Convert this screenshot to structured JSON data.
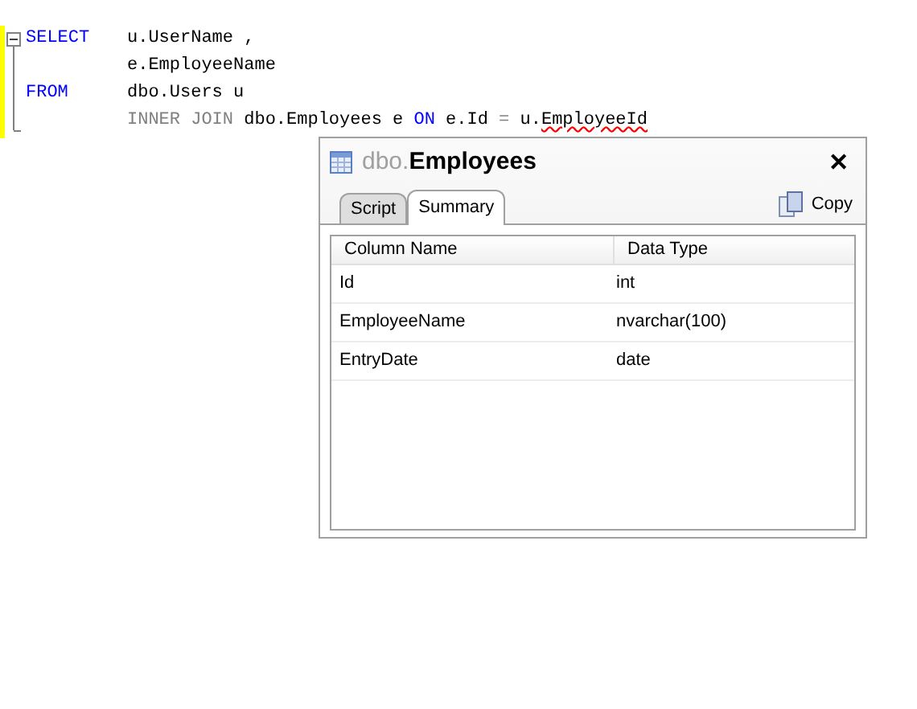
{
  "editor": {
    "lines": [
      {
        "keyword": "SELECT",
        "tokens": [
          {
            "text": "u.UserName ,",
            "kind": "plain"
          }
        ]
      },
      {
        "tokens": [
          {
            "text": "e.EmployeeName",
            "kind": "plain"
          }
        ]
      },
      {
        "keyword": "FROM",
        "tokens": [
          {
            "text": "dbo.Users u",
            "kind": "plain"
          }
        ]
      },
      {
        "tokens": [
          {
            "text": "INNER JOIN",
            "kind": "operator"
          },
          {
            "text": " dbo.Employees e ",
            "kind": "plain"
          },
          {
            "text": "ON",
            "kind": "keyword"
          },
          {
            "text": " e.Id ",
            "kind": "plain"
          },
          {
            "text": "=",
            "kind": "operator"
          },
          {
            "text": " u.",
            "kind": "plain"
          },
          {
            "text": "EmployeeId",
            "kind": "error"
          }
        ]
      }
    ]
  },
  "popup": {
    "schema": "dbo.",
    "name": "Employees",
    "close": "✕",
    "tabs": [
      {
        "label": "Script",
        "selected": false
      },
      {
        "label": "Summary",
        "selected": true
      }
    ],
    "copy": "Copy",
    "columns": [
      "Column Name",
      "Data Type"
    ],
    "rows": [
      [
        "Id",
        "int"
      ],
      [
        "EmployeeName",
        "nvarchar(100)"
      ],
      [
        "EntryDate",
        "date"
      ]
    ]
  }
}
